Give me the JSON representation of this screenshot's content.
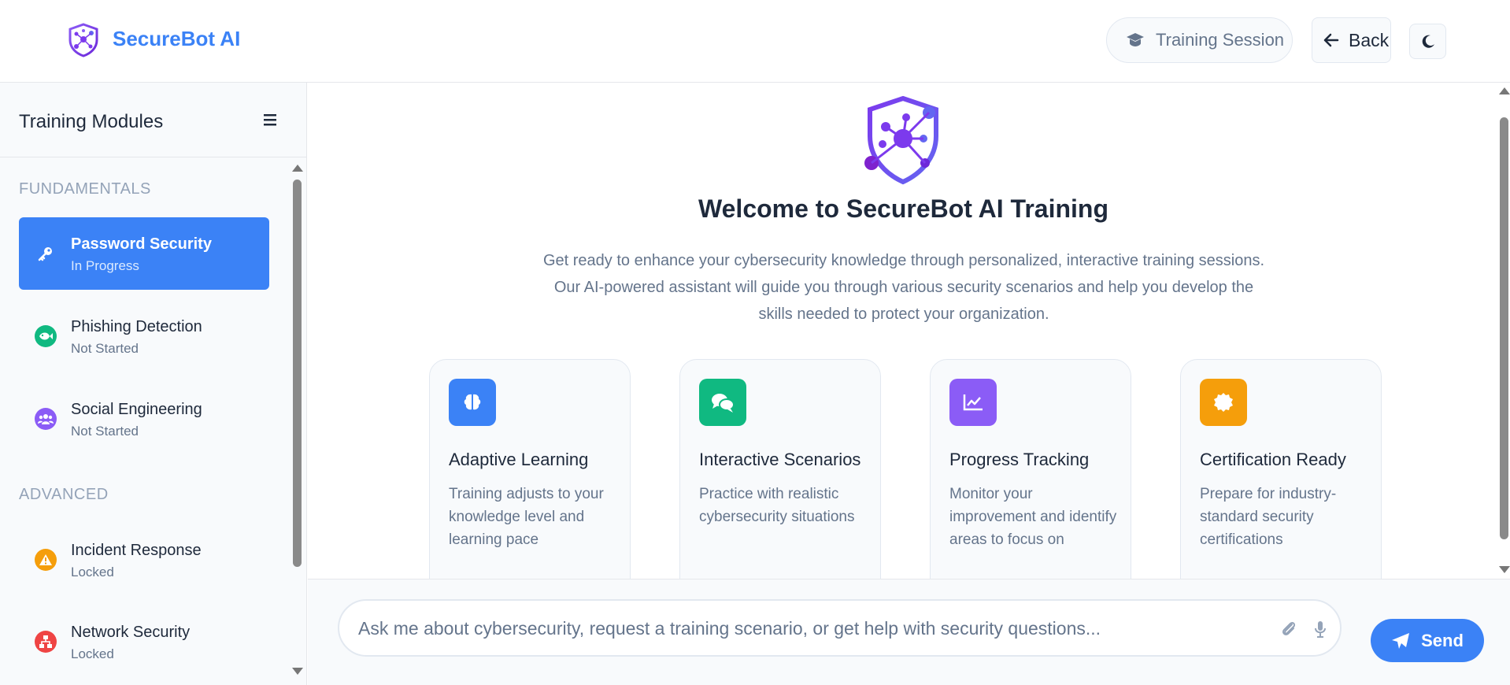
{
  "app": {
    "name": "SecureBot AI"
  },
  "header": {
    "session_label": "Training Session",
    "back_label": "Back"
  },
  "sidebar": {
    "title": "Training Modules",
    "sections": [
      {
        "label": "FUNDAMENTALS",
        "modules": [
          {
            "name": "Password Security",
            "status": "In Progress",
            "icon": "key-icon",
            "color": "#3b82f6",
            "active": true
          },
          {
            "name": "Phishing Detection",
            "status": "Not Started",
            "icon": "fish-icon",
            "color": "#10b981",
            "active": false
          },
          {
            "name": "Social Engineering",
            "status": "Not Started",
            "icon": "users-icon",
            "color": "#8b5cf6",
            "active": false
          }
        ]
      },
      {
        "label": "ADVANCED",
        "modules": [
          {
            "name": "Incident Response",
            "status": "Locked",
            "icon": "warning-icon",
            "color": "#f59e0b",
            "active": false
          },
          {
            "name": "Network Security",
            "status": "Locked",
            "icon": "network-icon",
            "color": "#ef4444",
            "active": false
          }
        ]
      }
    ]
  },
  "main": {
    "welcome_title": "Welcome to SecureBot AI Training",
    "welcome_text": "Get ready to enhance your cybersecurity knowledge through personalized, interactive training sessions. Our AI-powered assistant will guide you through various security scenarios and help you develop the skills needed to protect your organization.",
    "features": [
      {
        "title": "Adaptive Learning",
        "desc": "Training adjusts to your knowledge level and learning pace",
        "icon": "brain-icon",
        "color": "#3b82f6"
      },
      {
        "title": "Interactive Scenarios",
        "desc": "Practice with realistic cybersecurity situations",
        "icon": "chat-bubbles-icon",
        "color": "#10b981"
      },
      {
        "title": "Progress Tracking",
        "desc": "Monitor your improvement and identify areas to focus on",
        "icon": "chart-line-icon",
        "color": "#8b5cf6"
      },
      {
        "title": "Certification Ready",
        "desc": "Prepare for industry-standard security certifications",
        "icon": "certificate-icon",
        "color": "#f59e0b"
      }
    ]
  },
  "chat": {
    "placeholder": "Ask me about cybersecurity, request a training scenario, or get help with security questions...",
    "send_label": "Send"
  }
}
